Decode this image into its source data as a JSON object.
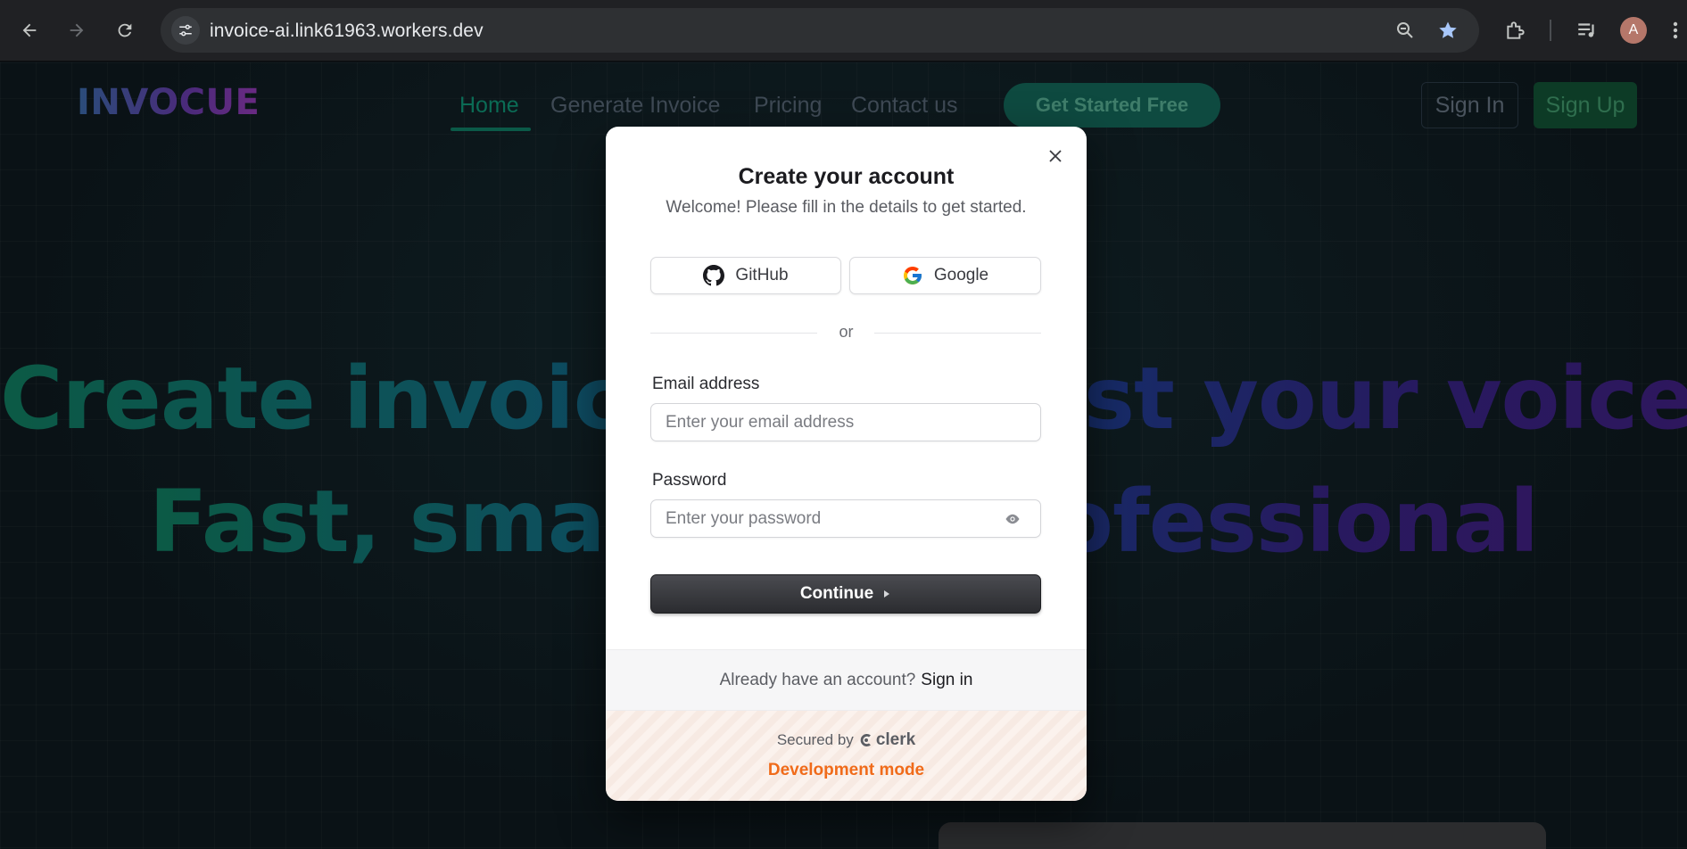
{
  "browser": {
    "url": "invoice-ai.link61963.workers.dev",
    "avatar_letter": "A",
    "icons": [
      "back-icon",
      "forward-icon",
      "reload-icon",
      "site-info-icon",
      "zoom-icon",
      "bookmark-star-icon",
      "extensions-icon",
      "media-controls-icon",
      "menu-icon"
    ]
  },
  "site": {
    "logo": "INVOCUE",
    "nav": [
      {
        "label": "Home",
        "active": true
      },
      {
        "label": "Generate Invoice",
        "active": false
      },
      {
        "label": "Pricing",
        "active": false
      },
      {
        "label": "Contact us",
        "active": false
      }
    ],
    "cta_label": "Get Started Free",
    "sign_in_label": "Sign In",
    "sign_up_label": "Sign Up",
    "hero_line1": "Create invoices with just your voice",
    "hero_line2": "Fast, smart, and professional"
  },
  "modal": {
    "title": "Create your account",
    "subtitle": "Welcome! Please fill in the details to get started.",
    "github_label": "GitHub",
    "google_label": "Google",
    "divider": "or",
    "email_label": "Email address",
    "email_placeholder": "Enter your email address",
    "email_value": "",
    "password_label": "Password",
    "password_placeholder": "Enter your password",
    "password_value": "",
    "continue_label": "Continue",
    "already_text": "Already have an account?",
    "signin_link": "Sign in",
    "secured_by": "Secured by",
    "clerk_brand": "clerk",
    "dev_mode": "Development mode"
  },
  "colors": {
    "accent_dark_button": "#2b2c30",
    "dev_mode_orange": "#f06b1a",
    "site_bg": "#0b1116",
    "nav_active": "#0b6b55"
  }
}
